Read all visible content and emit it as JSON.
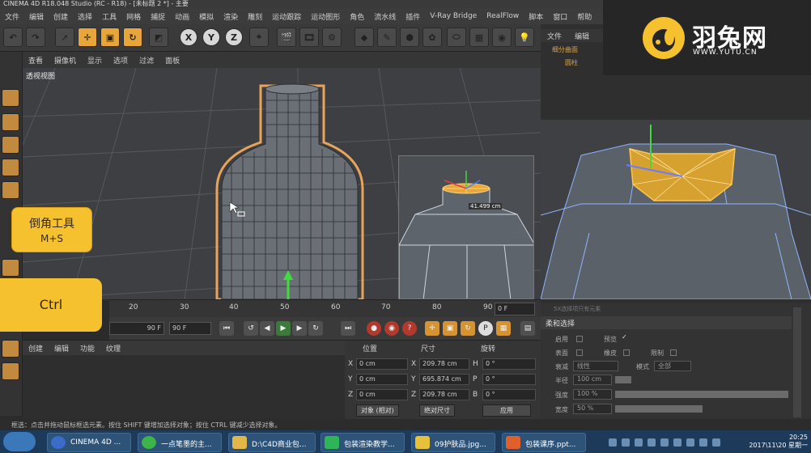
{
  "window": {
    "title": "CINEMA 4D R18.048 Studio (RC - R18) - [未标题 2 *] - 主要"
  },
  "menu": [
    "文件",
    "编辑",
    "创建",
    "选择",
    "工具",
    "网格",
    "捕捉",
    "动画",
    "模拟",
    "渲染",
    "雕刻",
    "运动跟踪",
    "运动图形",
    "角色",
    "流水线",
    "插件",
    "V-Ray Bridge",
    "RealFlow",
    "脚本",
    "窗口",
    "帮助"
  ],
  "toolbar": {
    "axis_x": "X",
    "axis_y": "Y",
    "axis_z": "Z"
  },
  "viewport": {
    "menu": [
      "查看",
      "摄像机",
      "显示",
      "选项",
      "过滤",
      "面板"
    ],
    "label": "透视视图",
    "inset_distance": "41.499 cm"
  },
  "object_manager": {
    "tabs": [
      "文件",
      "编辑"
    ],
    "items": [
      "细分曲面",
      "圆柱"
    ]
  },
  "logo": {
    "name": "羽兔网",
    "url": "WWW.YUTU.CN"
  },
  "overlays": {
    "bevel_tool": "倒角工具",
    "bevel_shortcut": "M+S",
    "ctrl_key": "Ctrl"
  },
  "timeline": {
    "ticks": [
      "20",
      "30",
      "40",
      "50",
      "60",
      "70",
      "80",
      "90"
    ],
    "current_frame": "0 F"
  },
  "playback": {
    "end_frame": "90 F",
    "max_frame": "90 F"
  },
  "material_manager": {
    "tabs": [
      "创建",
      "编辑",
      "功能",
      "纹理"
    ]
  },
  "coordinates": {
    "headers": [
      "位置",
      "尺寸",
      "旋转"
    ],
    "rows": [
      {
        "pos_axis": "X",
        "pos": "0 cm",
        "size_axis": "X",
        "size": "209.78 cm",
        "rot_axis": "H",
        "rot": "0 °"
      },
      {
        "pos_axis": "Y",
        "pos": "0 cm",
        "size_axis": "Y",
        "size": "695.874 cm",
        "rot_axis": "P",
        "rot": "0 °"
      },
      {
        "pos_axis": "Z",
        "pos": "0 cm",
        "size_axis": "Z",
        "size": "209.78 cm",
        "rot_axis": "B",
        "rot": "0 °"
      }
    ],
    "object_mode": "对象 (相对)",
    "size_mode": "绝对尺寸",
    "apply": "应用"
  },
  "attributes": {
    "hint": "5X选择项只有元素",
    "title": "柔和选择",
    "enable": "启用",
    "preview": "预览",
    "surface": "表面",
    "rubber": "橡皮",
    "restrict": "限制",
    "falloff_label": "衰减",
    "falloff_value": "线性",
    "mode_label": "模式",
    "mode_value": "全部",
    "radius_label": "半径",
    "radius_value": "100 cm",
    "strength_label": "强度",
    "strength_value": "100 %",
    "width_label": "宽度",
    "width_value": "50 %"
  },
  "status": "框选：点击并拖动鼠标框选元素。按住 SHIFT 键增加选择对象；按住 CTRL 键减少选择对象。",
  "taskbar": {
    "items": [
      "CINEMA 4D ...",
      "一点笔墨的主...",
      "D:\\C4D商业包...",
      "包装渲染教学...",
      "09护肤品.jpg...",
      "包装课序.ppt..."
    ],
    "time": "20:25",
    "date": "2017\\11\\20 星期一"
  },
  "colors": {
    "accent": "#e7a53a",
    "selection": "#e0a130",
    "taskbar": "#1e3a5a"
  }
}
